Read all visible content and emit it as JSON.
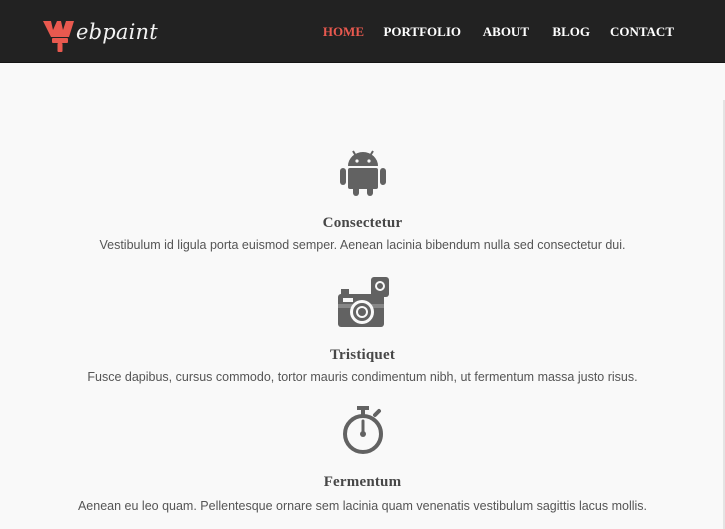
{
  "brand": {
    "name": "ebpaint",
    "logo_icon": "paintbrush-w-icon",
    "accent_color": "#e9594f"
  },
  "nav": {
    "items": [
      {
        "label": "HOME",
        "active": true
      },
      {
        "label": "PORTFOLIO",
        "active": false
      },
      {
        "label": "ABOUT",
        "active": false
      },
      {
        "label": "BLOG",
        "active": false
      },
      {
        "label": "CONTACT",
        "active": false
      }
    ]
  },
  "features": [
    {
      "icon": "android-icon",
      "title": "Consectetur",
      "text": "Vestibulum id ligula porta euismod semper. Aenean lacinia bibendum nulla sed consectetur dui."
    },
    {
      "icon": "camera-icon",
      "title": "Tristiquet",
      "text": "Fusce dapibus, cursus commodo, tortor mauris condimentum nibh, ut fermentum massa justo risus."
    },
    {
      "icon": "stopwatch-icon",
      "title": "Fermentum",
      "text": "Aenean eu leo quam. Pellentesque ornare sem lacinia quam venenatis vestibulum sagittis lacus mollis."
    }
  ]
}
